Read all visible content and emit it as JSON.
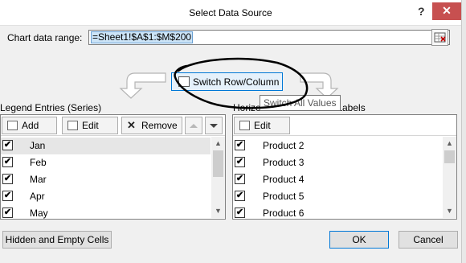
{
  "window": {
    "title": "Select Data Source",
    "help_label": "?",
    "close_label": "✕",
    "accent": "#0078d7",
    "close_color": "#c75050"
  },
  "range": {
    "label": "Chart data range:",
    "value": "=Sheet1!$A$1:$M$200"
  },
  "switch": {
    "label": "Switch Row/Column",
    "tooltip": "Switch All Values"
  },
  "legend": {
    "heading": "Legend Entries (Series)",
    "add_label": "Add",
    "edit_label": "Edit",
    "remove_label": "Remove",
    "items": [
      {
        "label": "Jan",
        "checked": true,
        "selected": true
      },
      {
        "label": "Feb",
        "checked": true
      },
      {
        "label": "Mar",
        "checked": true
      },
      {
        "label": "Apr",
        "checked": true
      },
      {
        "label": "May",
        "checked": true
      }
    ]
  },
  "axis": {
    "heading_start": "Horizo",
    "heading_end": "s Labels",
    "edit_label": "Edit",
    "items": [
      {
        "label": "Product 2",
        "checked": true
      },
      {
        "label": "Product 3",
        "checked": true
      },
      {
        "label": "Product 4",
        "checked": true
      },
      {
        "label": "Product 5",
        "checked": true
      },
      {
        "label": "Product 6",
        "checked": true
      }
    ]
  },
  "footer": {
    "hidden_label": "Hidden and Empty Cells",
    "ok_label": "OK",
    "cancel_label": "Cancel"
  },
  "icons": [
    "help-icon",
    "close-icon",
    "range-picker-icon",
    "switch-icon",
    "add-icon",
    "edit-icon",
    "remove-icon",
    "move-up-icon",
    "move-down-icon",
    "checkbox-icon",
    "scroll-up-icon",
    "scroll-down-icon"
  ]
}
